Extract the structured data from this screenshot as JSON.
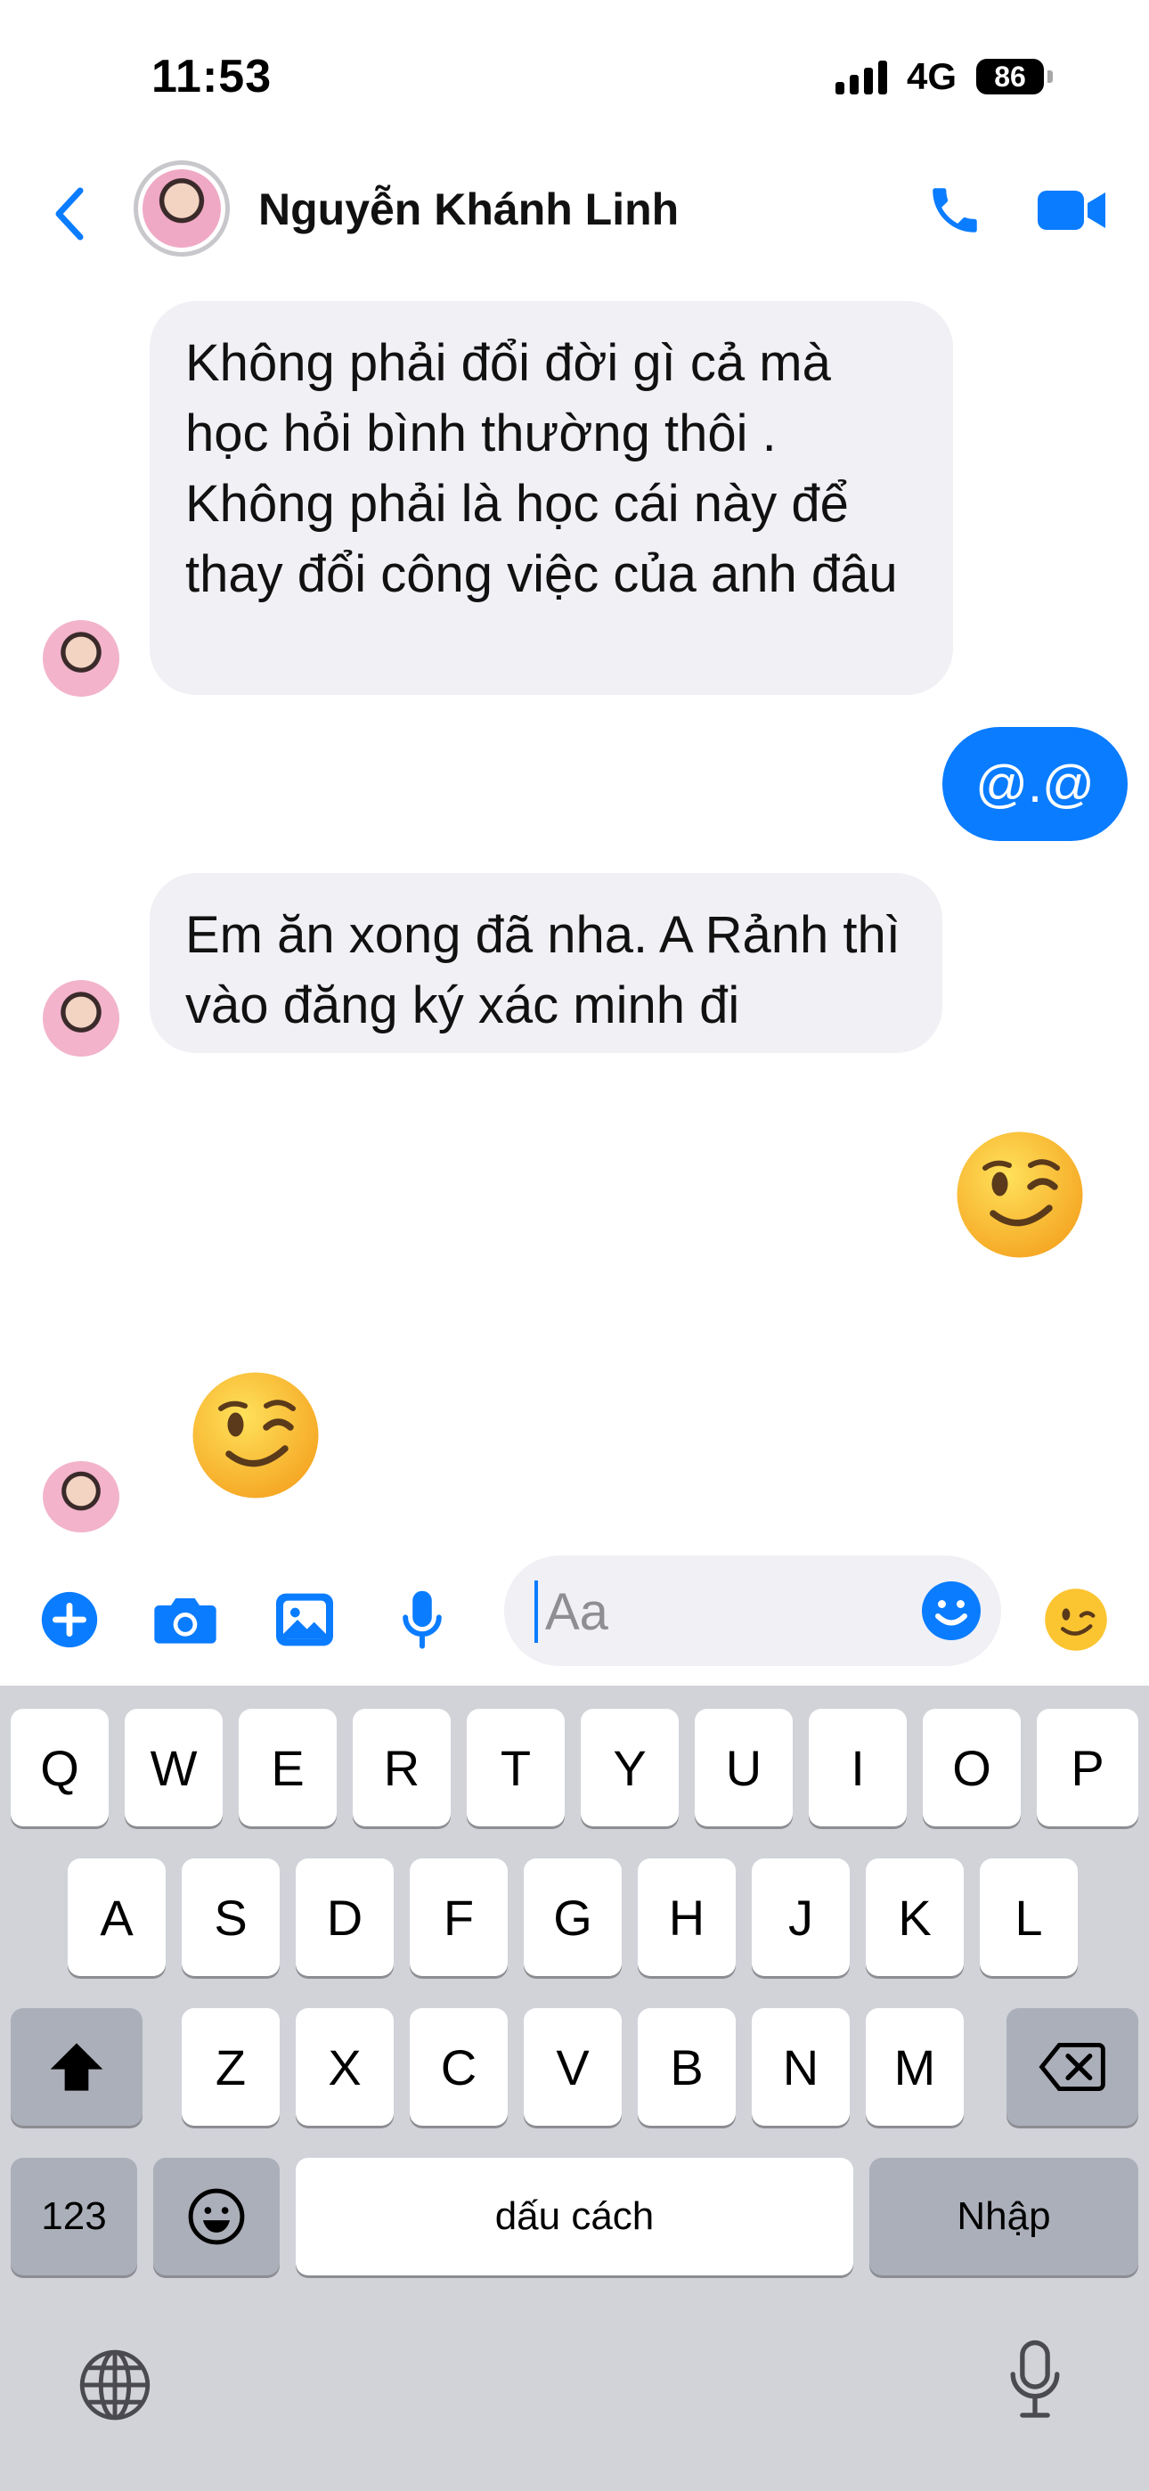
{
  "status_bar": {
    "time": "11:53",
    "network": "4G",
    "battery": "86"
  },
  "header": {
    "contact_name": "Nguyễn Khánh Linh"
  },
  "messages": [
    {
      "from": "them",
      "text": "Không phải đổi đời gì cả mà học hỏi bình thường thôi . Không phải là học cái này để thay đổi công việc của anh đâu"
    },
    {
      "from": "me",
      "text": "@.@"
    },
    {
      "from": "them",
      "text": "Em ăn xong đã nha. A Rảnh thì vào đăng ký xác minh đi"
    },
    {
      "from": "me",
      "emoji": "winking-face"
    },
    {
      "from": "them",
      "emoji": "winking-face"
    }
  ],
  "composer": {
    "placeholder": "Aa"
  },
  "keyboard": {
    "row1": [
      "Q",
      "W",
      "E",
      "R",
      "T",
      "Y",
      "U",
      "I",
      "O",
      "P"
    ],
    "row2": [
      "A",
      "S",
      "D",
      "F",
      "G",
      "H",
      "J",
      "K",
      "L"
    ],
    "row3": [
      "Z",
      "X",
      "C",
      "V",
      "B",
      "N",
      "M"
    ],
    "numbers_label": "123",
    "space_label": "dấu cách",
    "return_label": "Nhập"
  },
  "colors": {
    "accent": "#0a7cff",
    "bubble_in": "#f0f0f5",
    "keyboard_bg": "#d1d3d9"
  }
}
